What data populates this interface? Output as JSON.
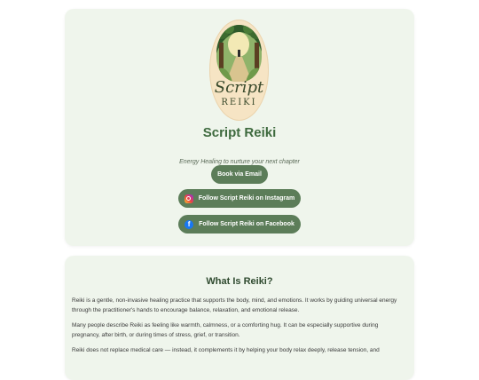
{
  "brand": {
    "logo_script": "Script",
    "logo_reiki": "REIKI",
    "title": "Script Reiki",
    "tagline": "Energy Healing to nurture your next chapter"
  },
  "buttons": {
    "email": "Book via Email",
    "instagram": "Follow Script Reiki on Instagram",
    "facebook": "Follow Script Reiki on Facebook"
  },
  "icons": {
    "instagram": "instagram-icon",
    "facebook": "facebook-icon"
  },
  "about": {
    "title": "What Is Reiki?",
    "paragraphs": [
      "Reiki is a gentle, non-invasive healing practice that supports the body, mind, and emotions. It works by guiding universal energy through the practitioner's hands to encourage balance, relaxation, and emotional release.",
      "Many people describe Reiki as feeling like warmth, calmness, or a comforting hug. It can be especially supportive during pregnancy, after birth, or during times of stress, grief, or transition.",
      "Reiki does not replace medical care — instead, it complements it by helping your body relax deeply, release tension, and"
    ]
  },
  "colors": {
    "card_bg": "#eff5ec",
    "accent": "#5c7d59",
    "title": "#3e6a3e",
    "logo_bg": "#f6e4c4"
  }
}
